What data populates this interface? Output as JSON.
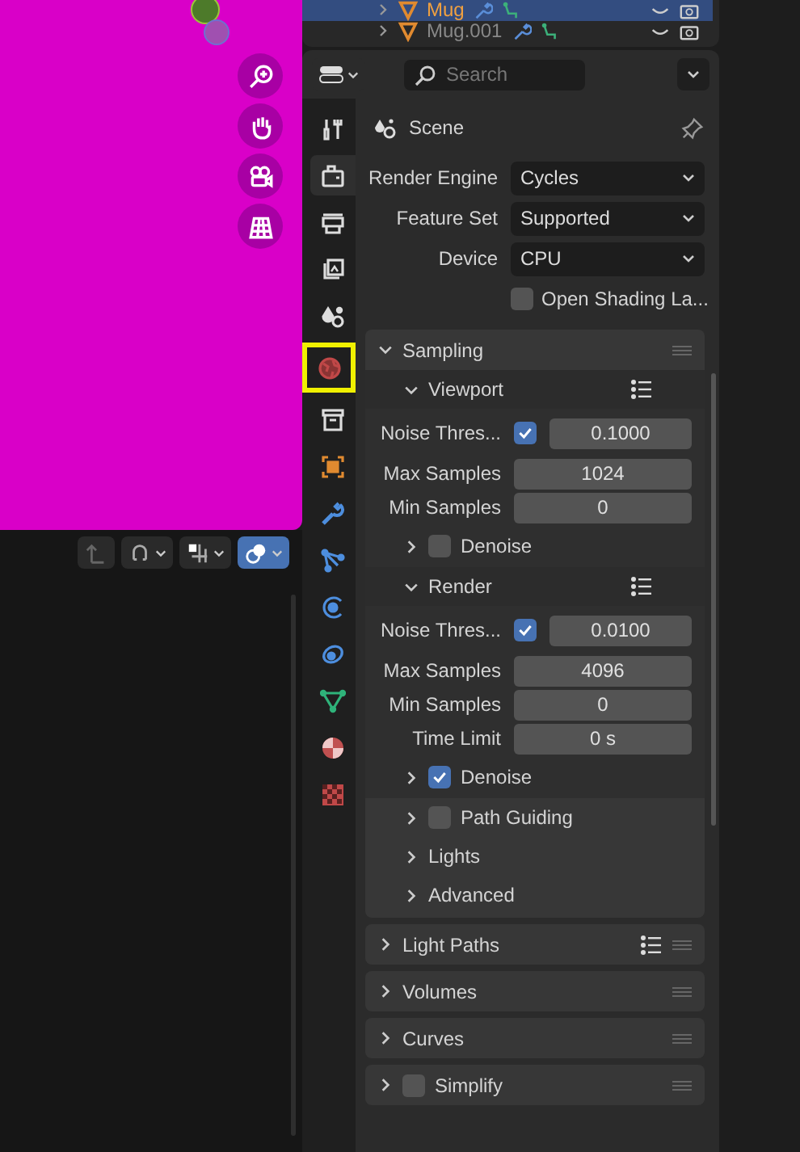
{
  "viewport": {
    "gizmo_buttons": [
      {
        "kind": "zoom"
      },
      {
        "kind": "hand"
      },
      {
        "kind": "camera"
      },
      {
        "kind": "grid"
      }
    ],
    "header_buttons": [
      {
        "kind": "parent",
        "on": false
      },
      {
        "kind": "snap",
        "on": false
      },
      {
        "kind": "snap_target",
        "on": false
      },
      {
        "kind": "proportional",
        "on": true
      }
    ]
  },
  "outliner": {
    "rows": [
      {
        "name": "Mug",
        "selected": true
      },
      {
        "name": "Mug.001",
        "selected": false
      }
    ]
  },
  "properties": {
    "search": {
      "placeholder": "Search"
    },
    "tabs": [
      {
        "kind": "tool",
        "selected": false,
        "highlighted": false
      },
      {
        "kind": "render",
        "selected": true,
        "highlighted": false
      },
      {
        "kind": "output",
        "selected": false,
        "highlighted": false
      },
      {
        "kind": "view_layer",
        "selected": false,
        "highlighted": false
      },
      {
        "kind": "scene",
        "selected": false,
        "highlighted": false
      },
      {
        "kind": "world",
        "selected": false,
        "highlighted": true
      },
      {
        "kind": "collection",
        "selected": false,
        "highlighted": false
      },
      {
        "kind": "object",
        "selected": false,
        "highlighted": false
      },
      {
        "kind": "modifiers",
        "selected": false,
        "highlighted": false
      },
      {
        "kind": "particles",
        "selected": false,
        "highlighted": false
      },
      {
        "kind": "physics",
        "selected": false,
        "highlighted": false
      },
      {
        "kind": "constraints",
        "selected": false,
        "highlighted": false
      },
      {
        "kind": "data",
        "selected": false,
        "highlighted": false
      },
      {
        "kind": "material",
        "selected": false,
        "highlighted": false
      },
      {
        "kind": "texture",
        "selected": false,
        "highlighted": false
      }
    ],
    "context": "Scene",
    "fields": [
      {
        "kind": "dropdown",
        "label": "Render Engine",
        "value": "Cycles"
      },
      {
        "kind": "dropdown",
        "label": "Feature Set",
        "value": "Supported"
      },
      {
        "kind": "dropdown",
        "label": "Device",
        "value": "CPU"
      },
      {
        "kind": "checkbox",
        "label": "Open Shading La...",
        "checked": false
      }
    ],
    "panels": [
      {
        "title": "Sampling",
        "expanded": true,
        "presets": false,
        "subpanels": [
          {
            "title": "Viewport",
            "expanded": true,
            "presets": true,
            "rows": [
              {
                "kind": "threshold",
                "label": "Noise Thres...",
                "checked": true,
                "value": "0.1000"
              },
              {
                "kind": "number",
                "label": "Max Samples",
                "value": "1024"
              },
              {
                "kind": "number",
                "label": "Min Samples",
                "value": "0"
              }
            ],
            "children": [
              {
                "title": "Denoise",
                "expanded": false,
                "checked": false
              }
            ]
          },
          {
            "title": "Render",
            "expanded": true,
            "presets": true,
            "rows": [
              {
                "kind": "threshold",
                "label": "Noise Thres...",
                "checked": true,
                "value": "0.0100"
              },
              {
                "kind": "number",
                "label": "Max Samples",
                "value": "4096"
              },
              {
                "kind": "number",
                "label": "Min Samples",
                "value": "0"
              },
              {
                "kind": "number",
                "label": "Time Limit",
                "value": "0 s"
              }
            ],
            "children": [
              {
                "title": "Denoise",
                "expanded": false,
                "checked": true
              }
            ]
          },
          {
            "title": "Path Guiding",
            "expanded": false,
            "checked": false
          },
          {
            "title": "Lights",
            "expanded": false
          },
          {
            "title": "Advanced",
            "expanded": false
          }
        ]
      },
      {
        "title": "Light Paths",
        "expanded": false,
        "presets": true
      },
      {
        "title": "Volumes",
        "expanded": false,
        "presets": false
      },
      {
        "title": "Curves",
        "expanded": false,
        "presets": false
      },
      {
        "title": "Simplify",
        "expanded": false,
        "presets": false,
        "checked": false
      }
    ]
  }
}
